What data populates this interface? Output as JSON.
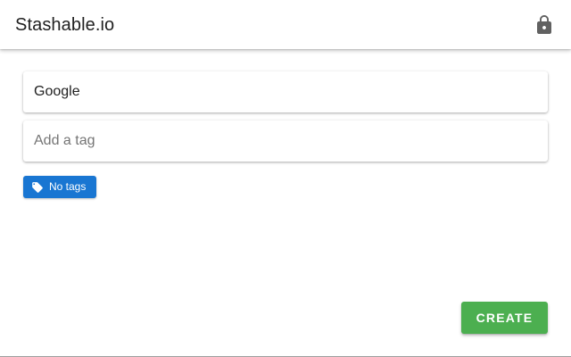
{
  "header": {
    "title": "Stashable.io",
    "lock_icon": "lock-icon"
  },
  "form": {
    "title_field": {
      "value": "Google",
      "placeholder": ""
    },
    "tag_field": {
      "value": "",
      "placeholder": "Add a tag"
    },
    "tag_chip": {
      "label": "No tags",
      "icon": "tag-icon"
    },
    "create_button": {
      "label": "CREATE"
    }
  },
  "colors": {
    "chip_blue": "#1976d2",
    "create_green": "#4caf50",
    "lock_grey": "#616161"
  }
}
